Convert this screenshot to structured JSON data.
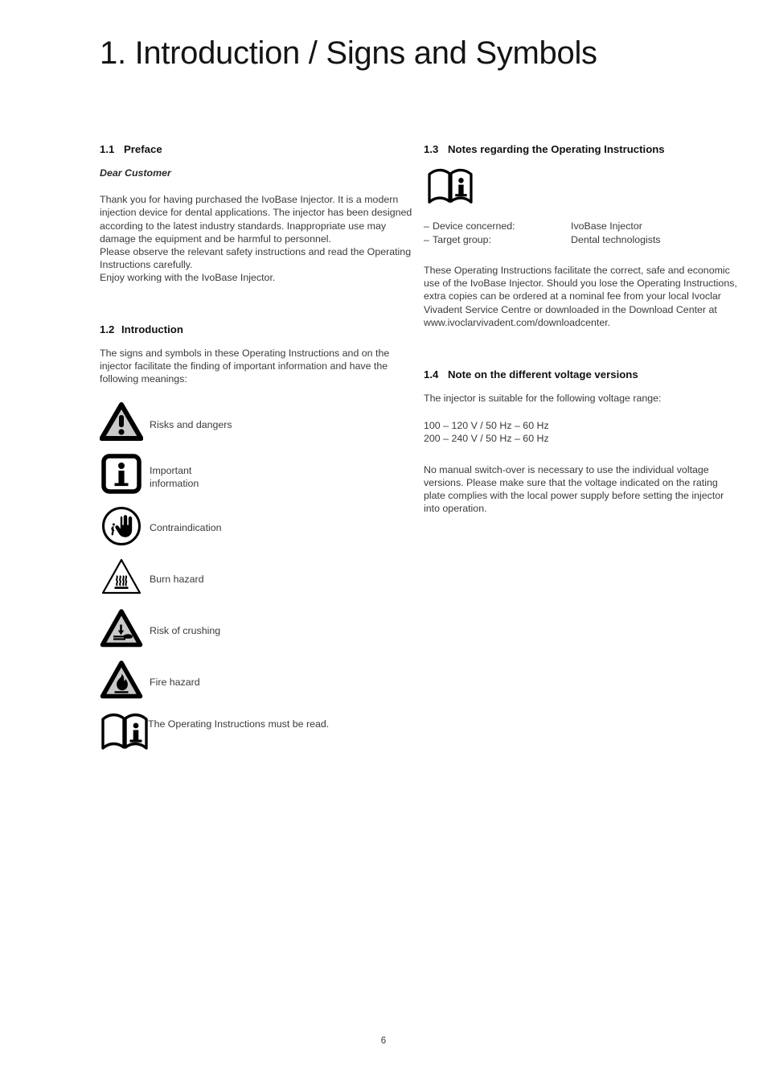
{
  "document": {
    "title": "1. Introduction / Signs and Symbols",
    "page_number": "6"
  },
  "sections": {
    "preface": {
      "number": "1.1",
      "heading": "Preface",
      "salutation": "Dear Customer",
      "body": "Thank you for having purchased the IvoBase Injector. It is a modern injection device for dental applications. The injector has been designed according to the latest industry standards. Inappropriate use may damage the equipment and be harmful to personnel.\nPlease observe the relevant safety instructions and read the Operating Instructions carefully.\nEnjoy working with the IvoBase Injector."
    },
    "introduction": {
      "number": "1.2",
      "heading": "Introduction",
      "body": "The signs and symbols in these Operating Instructions and on the injector facilitate the finding of important information and have the following meanings:"
    },
    "notes": {
      "number": "1.3",
      "heading": "Notes regarding the Operating Instructions",
      "icon": "operating-instructions-book-icon",
      "definitions": [
        {
          "dash": "–",
          "term": "Device concerned:",
          "value": "IvoBase Injector"
        },
        {
          "dash": "–",
          "term": "Target group:",
          "value": "Dental technologists"
        }
      ],
      "body": "These Operating Instructions facilitate the correct, safe and economic use of the IvoBase Injector. Should you lose the Operating Instructions, extra copies can be ordered at a nominal fee from your local Ivoclar Vivadent Service Centre or downloaded in the Download Center at www.ivoclarvivadent.com/downloadcenter."
    },
    "voltage": {
      "number": "1.4",
      "heading": "Note on the different voltage versions",
      "intro": "The injector is suitable for the following voltage range:",
      "ranges": [
        "100 – 120 V / 50 Hz – 60 Hz",
        "200 – 240 V / 50 Hz – 60 Hz"
      ],
      "body": "No manual switch-over is necessary to use the individual voltage versions. Please make sure that the voltage indicated on the rating plate complies with the local power supply before setting the injector into operation."
    }
  },
  "symbols": [
    {
      "icon": "warning-triangle-icon",
      "label": "Risks and dangers"
    },
    {
      "icon": "information-box-icon",
      "label": "Important\ninformation"
    },
    {
      "icon": "contraindication-hand-icon",
      "label": "Contraindication"
    },
    {
      "icon": "burn-hazard-icon",
      "label": "Burn hazard"
    },
    {
      "icon": "crushing-hazard-icon",
      "label": "Risk of crushing"
    },
    {
      "icon": "fire-hazard-icon",
      "label": "Fire hazard"
    },
    {
      "icon": "read-instructions-book-icon",
      "label": "The Operating Instructions must be read."
    }
  ],
  "colors": {
    "heading": "#111111",
    "body_text": "#3a3a3a",
    "icon_stroke": "#000000",
    "icon_fill": "#c9c9c9",
    "page_background": "#ffffff"
  }
}
